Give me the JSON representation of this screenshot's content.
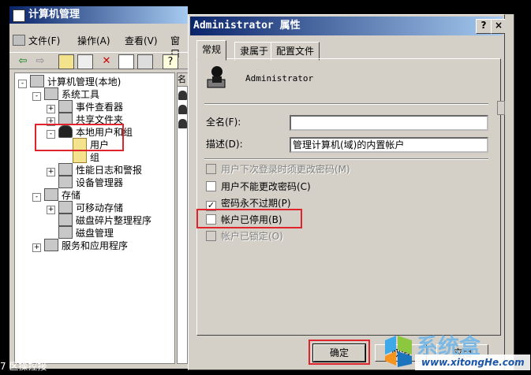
{
  "cm_window": {
    "title": "计算机管理",
    "menu": [
      "文件(F)",
      "操作(A)",
      "查看(V)",
      "窗口"
    ],
    "toolbar_icons": [
      "back-arrow-icon",
      "forward-arrow-icon",
      "up-folder-icon",
      "show-tree-icon",
      "delete-icon",
      "properties-icon",
      "export-icon",
      "help-icon"
    ],
    "tree": [
      {
        "label": "计算机管理(本地)",
        "depth": 0,
        "toggle": "-",
        "icon": "computer-icon"
      },
      {
        "label": "系统工具",
        "depth": 1,
        "toggle": "-",
        "icon": "tools-icon"
      },
      {
        "label": "事件查看器",
        "depth": 2,
        "toggle": "+",
        "icon": "event-viewer-icon"
      },
      {
        "label": "共享文件夹",
        "depth": 2,
        "toggle": "+",
        "icon": "shared-folder-icon"
      },
      {
        "label": "本地用户和组",
        "depth": 2,
        "toggle": "-",
        "icon": "users-icon"
      },
      {
        "label": "用户",
        "depth": 3,
        "toggle": "",
        "icon": "folder-icon"
      },
      {
        "label": "组",
        "depth": 3,
        "toggle": "",
        "icon": "folder-icon"
      },
      {
        "label": "性能日志和警报",
        "depth": 2,
        "toggle": "+",
        "icon": "performance-icon"
      },
      {
        "label": "设备管理器",
        "depth": 2,
        "toggle": "",
        "icon": "device-manager-icon"
      },
      {
        "label": "存储",
        "depth": 1,
        "toggle": "-",
        "icon": "storage-icon"
      },
      {
        "label": "可移动存储",
        "depth": 2,
        "toggle": "+",
        "icon": "removable-storage-icon"
      },
      {
        "label": "磁盘碎片整理程序",
        "depth": 2,
        "toggle": "",
        "icon": "defrag-icon"
      },
      {
        "label": "磁盘管理",
        "depth": 2,
        "toggle": "",
        "icon": "disk-icon"
      },
      {
        "label": "服务和应用程序",
        "depth": 1,
        "toggle": "+",
        "icon": "services-icon"
      }
    ],
    "list_header": "名",
    "status": "7      区操控接"
  },
  "dialog": {
    "title": "Administrator 属性",
    "help_label": "?",
    "close_label": "×",
    "tabs": [
      "常规",
      "隶属于",
      "配置文件"
    ],
    "account_name": "Administrator",
    "fullname_label": "全名(F):",
    "fullname_value": "",
    "desc_label": "描述(D):",
    "desc_value": "管理计算机(域)的内置帐户",
    "checkboxes": [
      {
        "label": "用户下次登录时须更改密码(M)",
        "checked": false,
        "disabled": true
      },
      {
        "label": "用户不能更改密码(C)",
        "checked": false,
        "disabled": false
      },
      {
        "label": "密码永不过期(P)",
        "checked": true,
        "disabled": false
      },
      {
        "label": "帐户已停用(B)",
        "checked": false,
        "disabled": false
      },
      {
        "label": "帐户已锁定(O)",
        "checked": false,
        "disabled": true
      }
    ],
    "ok_label": "确定",
    "cancel_label": "取消",
    "apply_label": "应用"
  },
  "watermark": {
    "text": "系统盒",
    "url": "www.xitongHe.com"
  },
  "colors": {
    "title_bar": "#0a246a",
    "highlight_box": "#e0242c",
    "window_face": "#d4d0c8"
  }
}
